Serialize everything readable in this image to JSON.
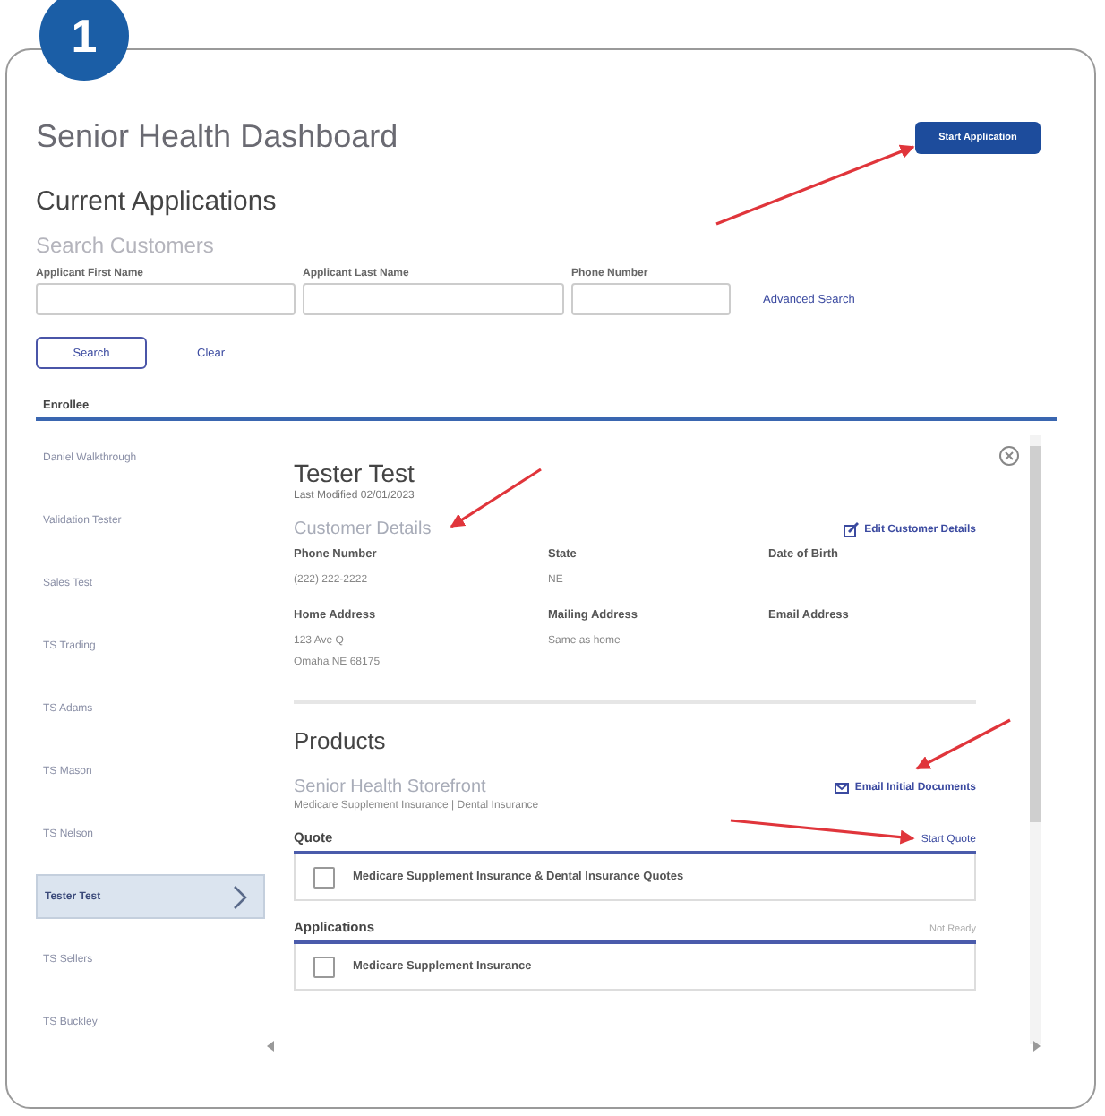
{
  "step_badge": "1",
  "header": {
    "title": "Senior Health Dashboard",
    "action_button": "Start Application"
  },
  "section_title": "Current Applications",
  "search": {
    "title": "Search Customers",
    "fields": [
      {
        "label": "Applicant First Name"
      },
      {
        "label": "Applicant Last Name"
      },
      {
        "label": "Phone Number"
      }
    ],
    "advanced_link": "Advanced Search",
    "search_button": "Search",
    "clear_link": "Clear"
  },
  "enrollees": {
    "heading": "Enrollee",
    "items": [
      {
        "name": "Daniel Walkthrough",
        "selected": false
      },
      {
        "name": "Validation Tester",
        "selected": false
      },
      {
        "name": "Sales Test",
        "selected": false
      },
      {
        "name": "TS Trading",
        "selected": false
      },
      {
        "name": "TS Adams",
        "selected": false
      },
      {
        "name": "TS Mason",
        "selected": false
      },
      {
        "name": "TS Nelson",
        "selected": false
      },
      {
        "name": "Tester Test",
        "selected": true
      },
      {
        "name": "TS Sellers",
        "selected": false
      },
      {
        "name": "TS Buckley",
        "selected": false
      }
    ]
  },
  "detail": {
    "name": "Tester Test",
    "last_modified": "Last Modified 02/01/2023",
    "customer_details": {
      "title": "Customer Details",
      "edit_link": "Edit Customer Details",
      "fields": [
        {
          "label": "Phone Number",
          "lines": [
            "(222) 222-2222"
          ]
        },
        {
          "label": "State",
          "lines": [
            "NE"
          ]
        },
        {
          "label": "Date of Birth"
        },
        {
          "label": "Home Address",
          "lines": [
            "123 Ave Q",
            "Omaha NE 68175"
          ]
        },
        {
          "label": "Mailing Address",
          "lines": [
            "Same as home"
          ]
        },
        {
          "label": "Email Address"
        }
      ]
    },
    "products": {
      "title": "Products",
      "storefront": "Senior Health Storefront",
      "subtitle": "Medicare Supplement Insurance | Dental Insurance",
      "email_link": "Email Initial Documents",
      "sections": [
        {
          "title": "Quote",
          "action": "Start Quote",
          "items": [
            {
              "label": "Medicare Supplement Insurance & Dental Insurance Quotes",
              "checked": false
            }
          ]
        },
        {
          "title": "Applications",
          "status": "Not Ready",
          "items": [
            {
              "label": "Medicare Supplement Insurance",
              "checked": false
            }
          ]
        }
      ]
    }
  }
}
